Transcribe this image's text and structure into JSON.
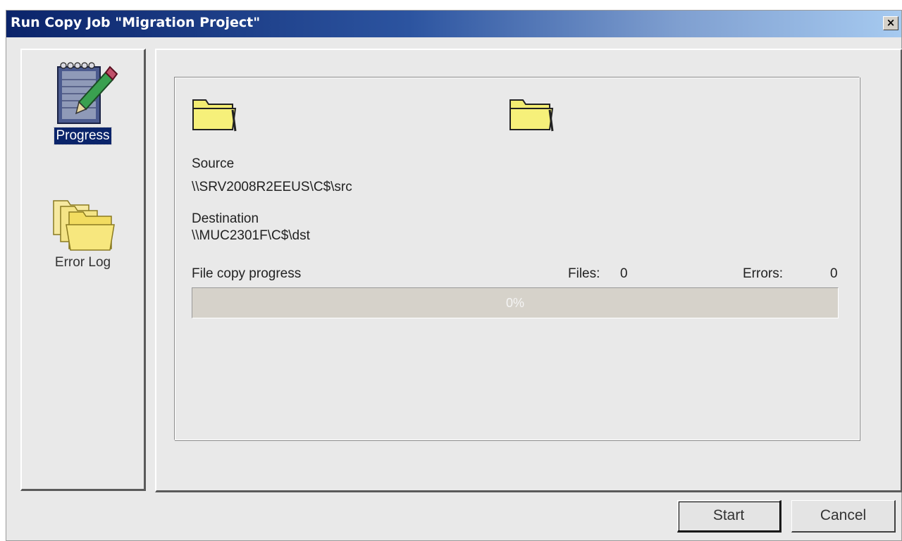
{
  "window": {
    "title": "Run Copy Job \"Migration Project\"",
    "close_label": "×"
  },
  "sidebar": {
    "items": [
      {
        "label": "Progress",
        "icon": "notepad-pencil-icon",
        "selected": true
      },
      {
        "label": "Error Log",
        "icon": "folders-icon",
        "selected": false
      }
    ]
  },
  "main": {
    "source_label": "Source",
    "source_path": "\\\\SRV2008R2EEUS\\C$\\src",
    "destination_label": "Destination",
    "destination_path": "\\\\MUC2301F\\C$\\dst",
    "progress_label": "File copy progress",
    "files_label": "Files:",
    "files_count": "0",
    "errors_label": "Errors:",
    "errors_count": "0",
    "progress_text": "0%",
    "progress_value": 0
  },
  "buttons": {
    "start": "Start",
    "cancel": "Cancel"
  },
  "colors": {
    "title_dark": "#0b246a",
    "title_light": "#a6caf0",
    "folder": "#f2ec72",
    "selection": "#0a246a"
  }
}
